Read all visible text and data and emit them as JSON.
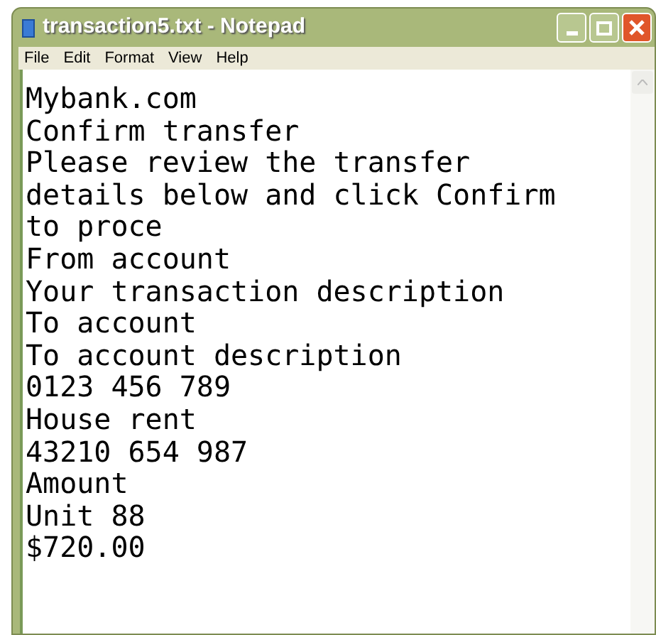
{
  "window": {
    "title": "transaction5.txt - Notepad"
  },
  "menu": [
    "File",
    "Edit",
    "Format",
    "View",
    "Help"
  ],
  "document": {
    "lines": [
      "Mybank.com",
      "Confirm transfer",
      "Please review the transfer",
      "details below and click Confirm",
      "to proce",
      "From account",
      "Your transaction description",
      "To account",
      "To account description",
      "0123 456 789",
      "House rent",
      "43210 654 987",
      "Amount",
      "Unit 88",
      "$720.00"
    ]
  }
}
